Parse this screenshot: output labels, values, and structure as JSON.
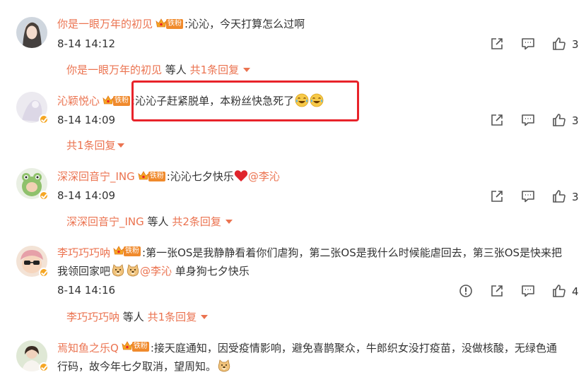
{
  "comments": [
    {
      "username": "你是一眼万年的初见",
      "fan_tag": "铁粉",
      "text": ":沁沁，今天打算怎么过啊",
      "time": "8-14 14:12",
      "likes": "3",
      "replies": {
        "prefix": "你是一眼万年的初见",
        "middle": " 等人 ",
        "link": "共1条回复"
      }
    },
    {
      "username": "沁颖悦心",
      "fan_tag": "铁粉",
      "text": ":沁沁子赶紧脱单，本粉丝快急死了",
      "time": "8-14 14:09",
      "likes": "3",
      "replies": {
        "link": "共1条回复"
      }
    },
    {
      "username": "深深回音宁_ING",
      "fan_tag": "铁粉",
      "text": ":沁沁七夕快乐",
      "mention": "@李沁",
      "time": "8-14 14:09",
      "likes": "3",
      "replies": {
        "prefix": "深深回音宁_ING",
        "middle": " 等人 ",
        "link": "共2条回复"
      }
    },
    {
      "username": "李巧巧巧呐",
      "fan_tag": "铁粉",
      "text": ":第一张OS是我静静看着你们虐狗，第二张OS是我什么时候能虐回去，第三张OS是快来把我领回家吧",
      "mention": "@李沁",
      "text_after": " 单身狗七夕快乐",
      "time": "8-14 14:16",
      "likes": "4",
      "replies": {
        "prefix": "李巧巧巧呐",
        "middle": " 等人 ",
        "link": "共1条回复"
      }
    },
    {
      "username": "焉知鱼之乐Q",
      "fan_tag": "铁粉",
      "text": ":接天庭通知，因受疫情影响，避免喜鹊聚众，牛郎织女没打疫苗，没做核酸，无绿色通行码，故今年七夕取消，望周知。"
    }
  ],
  "colors": {
    "accent": "#eb7350",
    "highlight_box": "#e8232a",
    "fan_badge": "#f08a2c",
    "verified": "#f5a623"
  },
  "icons": [
    "share-icon",
    "comment-icon",
    "like-icon",
    "report-icon",
    "crown-icon",
    "laugh-cry-emoji",
    "doge-emoji",
    "heart-emoji"
  ]
}
